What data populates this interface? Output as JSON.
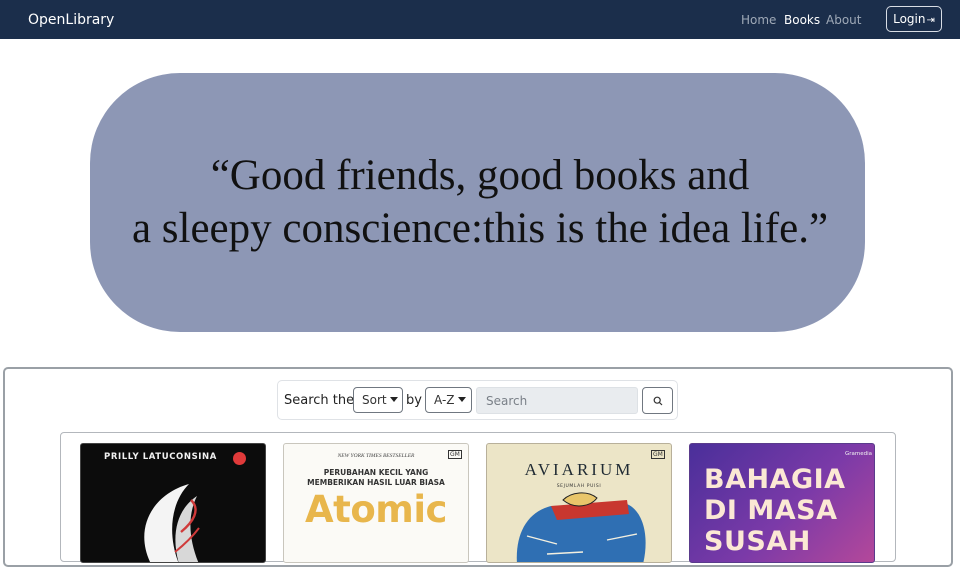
{
  "navbar": {
    "brand": "OpenLibrary",
    "links": [
      {
        "label": "Home",
        "active": false
      },
      {
        "label": "Books",
        "active": true
      },
      {
        "label": "About",
        "active": false
      }
    ],
    "login_label": "Login",
    "login_icon": "box-arrow-in-right-icon"
  },
  "hero": {
    "quote_line_1": "“Good friends, good books and",
    "quote_line_2": "a sleepy conscience:this is the idea life.”"
  },
  "search": {
    "prefix_label": "Search the",
    "sort_label": "Sort",
    "by_label": "by",
    "order_label": "A-Z",
    "input_placeholder": "Search",
    "input_value": "",
    "button_icon": "search-icon"
  },
  "books": [
    {
      "cover_text": "PRILLY LATUCONSINA",
      "cover_color": "#0c0c0c"
    },
    {
      "cover_tag": "NEW YORK TIMES BESTSELLER",
      "cover_subtitle": "PERUBAHAN KECIL YANG MEMBERIKAN HASIL LUAR BIASA",
      "cover_title": "Atomic",
      "publisher": "GM",
      "cover_color": "#fbfaf6"
    },
    {
      "cover_title": "AVIARIUM",
      "cover_subtitle": "SEJUMLAH PUISI",
      "publisher": "GM",
      "cover_color": "#ece5c7"
    },
    {
      "cover_title_line_1": "BAHAGIA",
      "cover_title_line_2": "DI MASA",
      "cover_title_line_3": "SUSAH",
      "publisher": "Gramedia",
      "cover_color": "#6b3aa6"
    }
  ],
  "colors": {
    "navbar_bg": "#1b2e4b",
    "hero_bg": "#8d97b5",
    "nav_active": "#ffffff",
    "nav_inactive": "#9fa9b7"
  }
}
